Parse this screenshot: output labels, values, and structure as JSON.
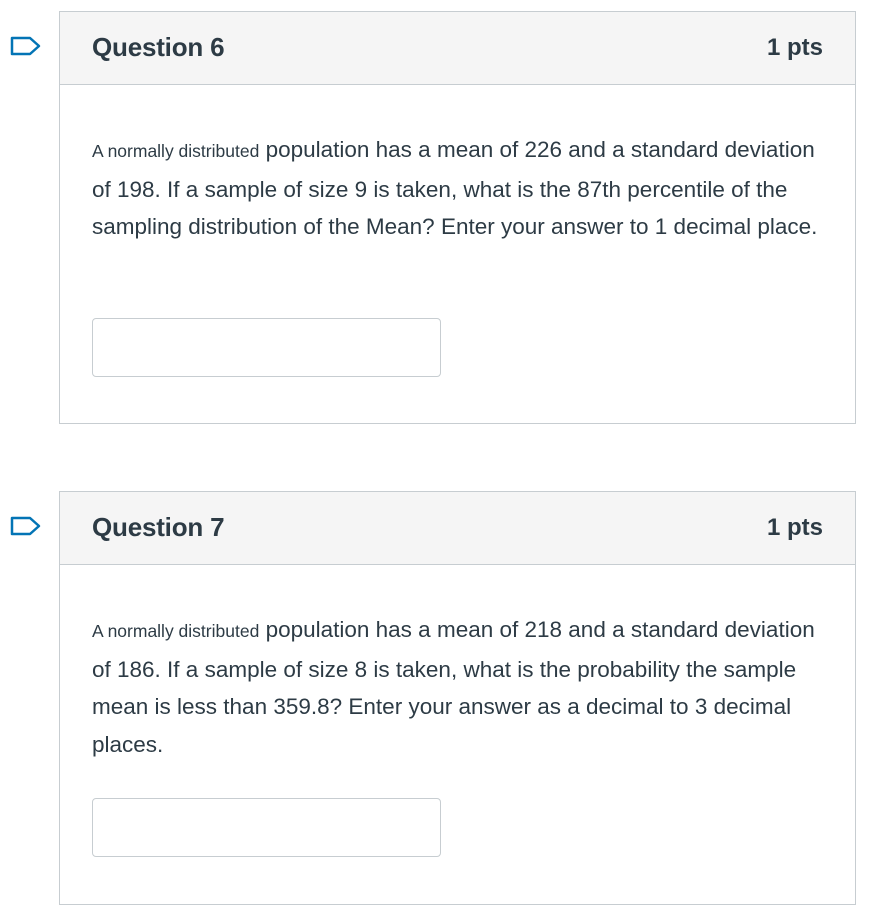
{
  "questions": [
    {
      "title": "Question 6",
      "points": "1 pts",
      "text_prefix_small": "A normally distributed",
      "text": " population has a mean of 226 and a standard deviation of 198.  If a sample of size 9 is taken, what is the 87th percentile of the sampling distribution of the Mean? Enter your answer to 1 decimal place.",
      "answer_value": "",
      "answer_placeholder": ""
    },
    {
      "title": "Question 7",
      "points": "1 pts",
      "text_prefix_small": "A normally distributed",
      "text": " population has a mean of 218 and a standard deviation of 186.  If a sample of size 8 is taken, what is the probability the sample mean is less than 359.8?  Enter your answer as a decimal to 3 decimal places.",
      "answer_value": "",
      "answer_placeholder": ""
    }
  ],
  "icons": {
    "flag": "flag-question-icon"
  },
  "colors": {
    "flag_stroke": "#0374b5",
    "header_bg": "#f5f5f5",
    "border": "#c7cdd1",
    "text": "#2d3b45"
  }
}
